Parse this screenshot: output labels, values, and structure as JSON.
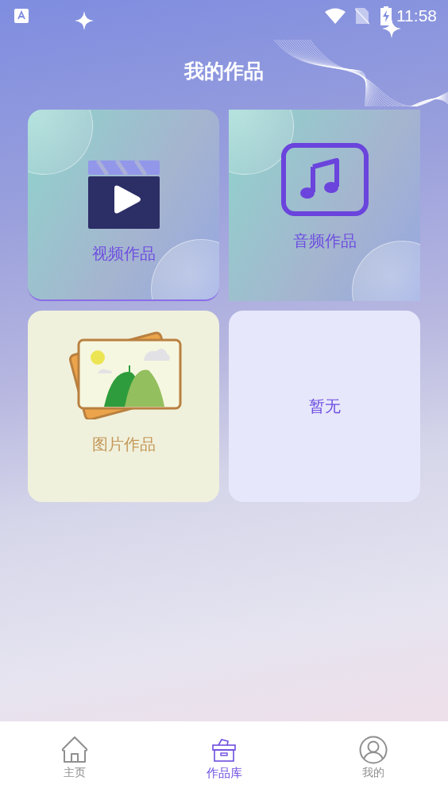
{
  "status_bar": {
    "time": "11:58"
  },
  "header": {
    "title": "我的作品"
  },
  "works": [
    {
      "kind": "video",
      "label": "视频作品"
    },
    {
      "kind": "audio",
      "label": "音频作品"
    },
    {
      "kind": "image",
      "label": "图片作品"
    },
    {
      "kind": "empty",
      "label": "暂无"
    }
  ],
  "nav": [
    {
      "kind": "home",
      "label": "主页",
      "selected": false
    },
    {
      "kind": "library",
      "label": "作品库",
      "selected": true
    },
    {
      "kind": "profile",
      "label": "我的",
      "selected": false
    }
  ]
}
